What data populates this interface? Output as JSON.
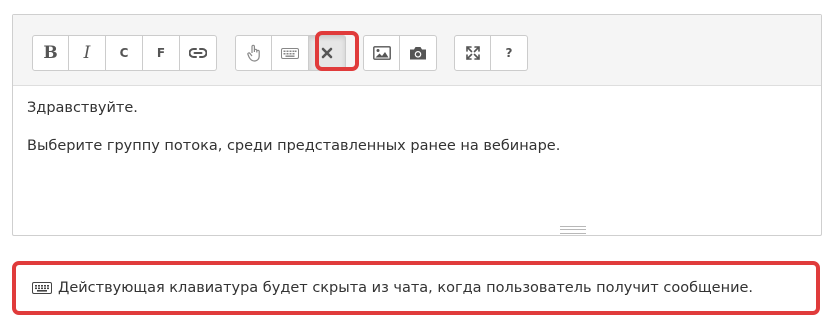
{
  "toolbar": {
    "groups": [
      [
        {
          "name": "bold-button",
          "icon": "bold-icon",
          "label": "B",
          "style": "b"
        },
        {
          "name": "italic-button",
          "icon": "italic-icon",
          "label": "I",
          "style": "i"
        },
        {
          "name": "code-button",
          "icon": "c-icon",
          "label": "C",
          "style": "sm"
        },
        {
          "name": "fixed-button",
          "icon": "f-icon",
          "label": "F",
          "style": "sm"
        },
        {
          "name": "link-button",
          "icon": "link-icon",
          "svg": "link"
        }
      ],
      [
        {
          "name": "button-button",
          "icon": "pointer-hand-icon",
          "svg": "hand"
        },
        {
          "name": "keyboard-button",
          "icon": "keyboard-icon",
          "svg": "keyboard"
        },
        {
          "name": "remove-keyboard-button",
          "icon": "close-icon",
          "svg": "close",
          "active": true
        }
      ],
      [
        {
          "name": "image-button",
          "icon": "image-icon",
          "svg": "image"
        },
        {
          "name": "photo-button",
          "icon": "camera-icon",
          "svg": "camera"
        }
      ],
      [
        {
          "name": "fullscreen-button",
          "icon": "expand-icon",
          "svg": "expand"
        },
        {
          "name": "help-button",
          "icon": "question-icon",
          "label": "?",
          "style": "q"
        }
      ]
    ]
  },
  "editor": {
    "line1": "Здравствуйте.",
    "line2": "Выберите группу потока, среди представленных ранее на вебинаре."
  },
  "notice": {
    "icon": "keyboard-icon",
    "text": "Действующая клавиатура будет скрыта из чата, когда пользователь получит сообщение."
  },
  "colors": {
    "highlight": "#e03b3b",
    "toolbar_bg": "#f5f5f5",
    "text": "#333333"
  }
}
